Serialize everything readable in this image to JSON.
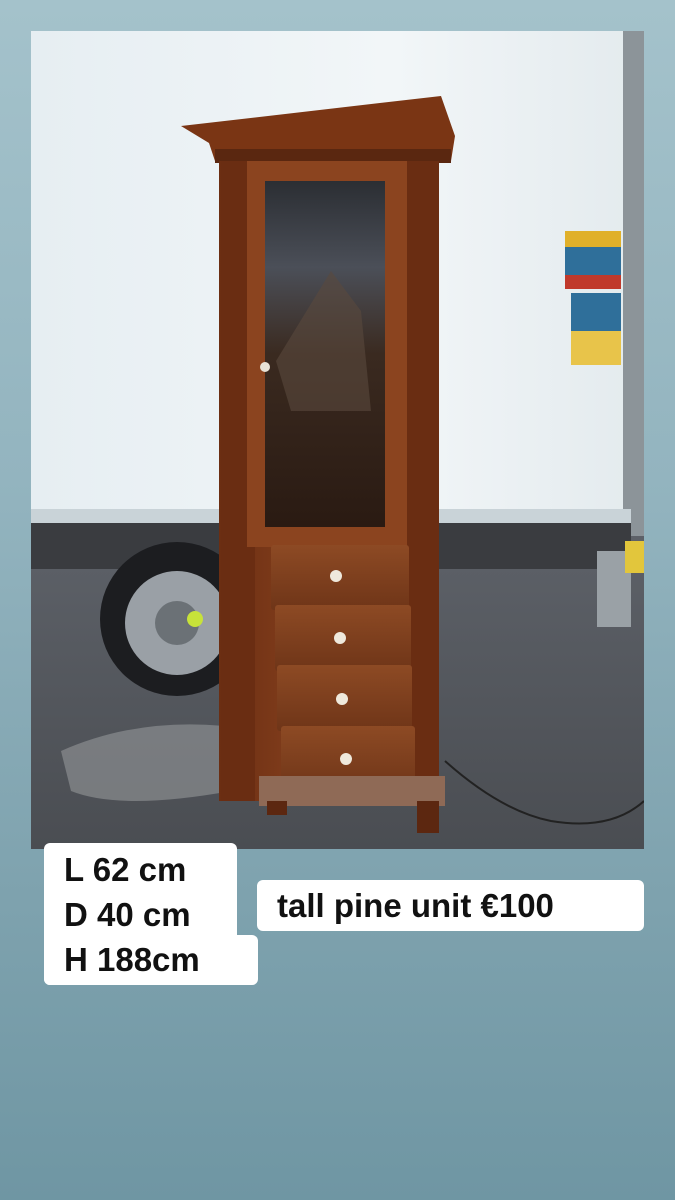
{
  "photo": {
    "subject": "tall pine glass-door cabinet with four drawers in front of a white truck"
  },
  "dimensions": {
    "length": "L 62 cm",
    "depth": "D 40 cm",
    "height": "H 188cm"
  },
  "listing": {
    "title_price": "tall pine unit €100"
  },
  "colors": {
    "background": "#93b4bf",
    "label_bg": "#ffffff",
    "label_text": "#111111",
    "wood": "#7a3a18"
  }
}
